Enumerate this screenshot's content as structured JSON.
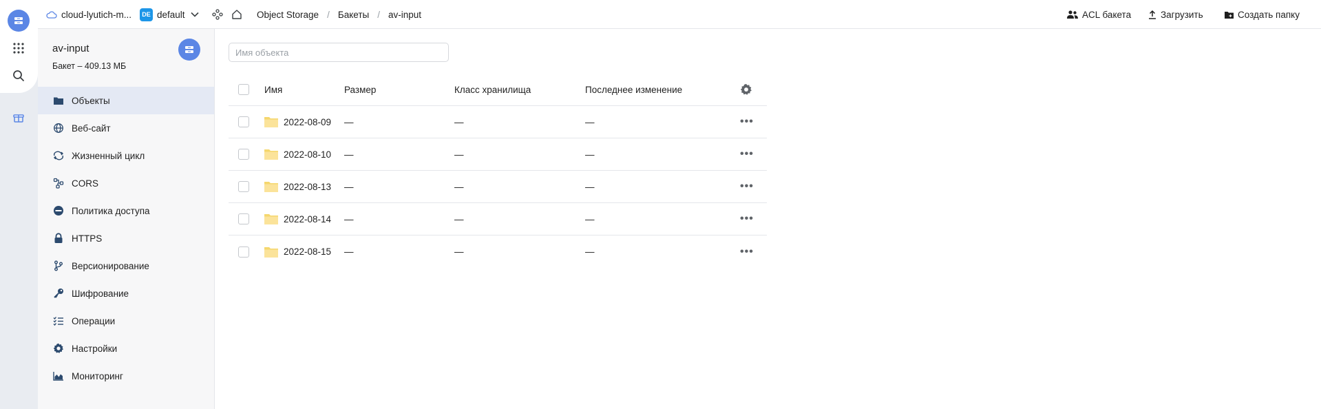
{
  "topbar": {
    "cloud_name": "cloud-lyutich-m...",
    "folder_badge": "DE",
    "folder_name": "default",
    "breadcrumbs": [
      "Object Storage",
      "Бакеты",
      "av-input"
    ],
    "separator": "/",
    "actions": {
      "acl": "ACL бакета",
      "upload": "Загрузить",
      "create_folder": "Создать папку"
    }
  },
  "bucket": {
    "name": "av-input",
    "size": "Бакет – 409.13 МБ"
  },
  "sidebar": {
    "items": [
      {
        "label": "Объекты",
        "icon": "folder-icon",
        "active": true
      },
      {
        "label": "Веб-сайт",
        "icon": "globe-icon"
      },
      {
        "label": "Жизненный цикл",
        "icon": "cycle-icon"
      },
      {
        "label": "CORS",
        "icon": "cors-icon"
      },
      {
        "label": "Политика доступа",
        "icon": "no-entry-icon"
      },
      {
        "label": "HTTPS",
        "icon": "lock-icon"
      },
      {
        "label": "Версионирование",
        "icon": "branch-icon"
      },
      {
        "label": "Шифрование",
        "icon": "key-icon"
      },
      {
        "label": "Операции",
        "icon": "checklist-icon"
      },
      {
        "label": "Настройки",
        "icon": "gear-icon"
      },
      {
        "label": "Мониторинг",
        "icon": "chart-icon"
      }
    ]
  },
  "search": {
    "placeholder": "Имя объекта"
  },
  "table": {
    "columns": {
      "name": "Имя",
      "size": "Размер",
      "storage_class": "Класс хранилища",
      "modified": "Последнее изменение"
    },
    "rows": [
      {
        "name": "2022-08-09",
        "size": "—",
        "storage_class": "—",
        "modified": "—"
      },
      {
        "name": "2022-08-10",
        "size": "—",
        "storage_class": "—",
        "modified": "—"
      },
      {
        "name": "2022-08-13",
        "size": "—",
        "storage_class": "—",
        "modified": "—"
      },
      {
        "name": "2022-08-14",
        "size": "—",
        "storage_class": "—",
        "modified": "—"
      },
      {
        "name": "2022-08-15",
        "size": "—",
        "storage_class": "—",
        "modified": "—"
      }
    ],
    "row_menu": "•••"
  },
  "colors": {
    "accent": "#5b86e5",
    "badge": "#1d96e8",
    "active_nav": "#e4e9f4",
    "folder": "#f5d76e"
  }
}
